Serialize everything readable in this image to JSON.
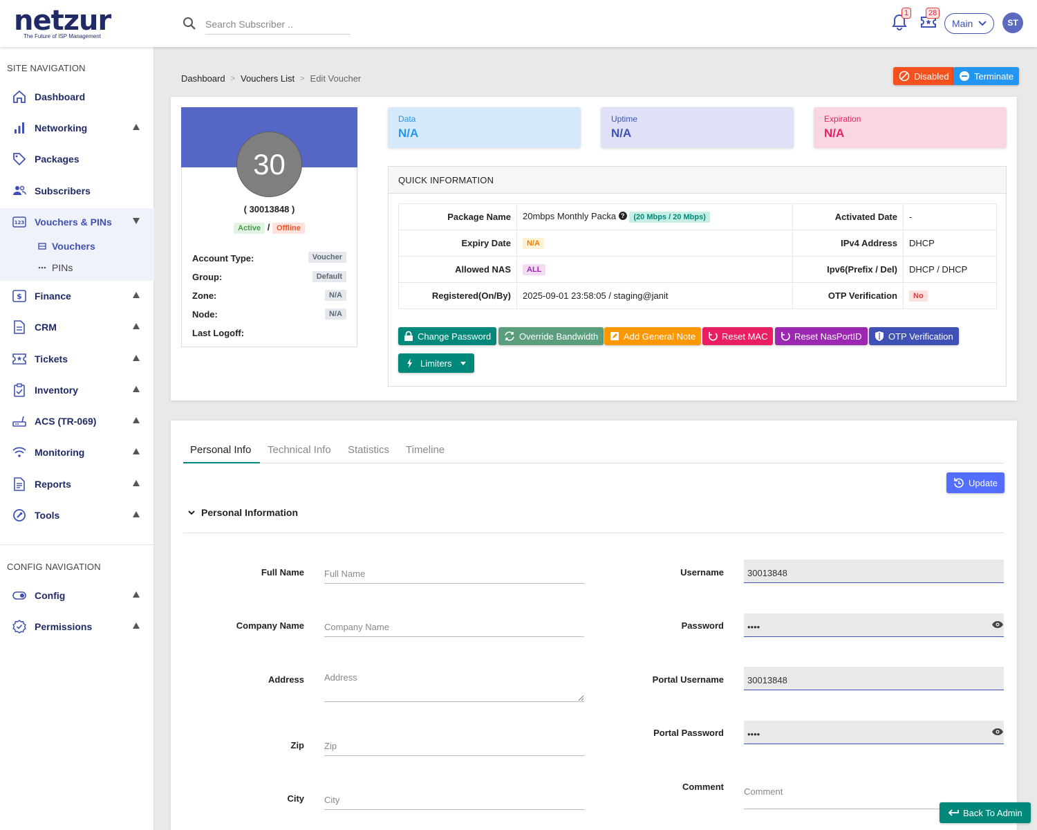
{
  "logo": {
    "word": "netzur",
    "tagline": "The Future of ISP Management"
  },
  "header": {
    "search_placeholder": "Search Subscriber ..",
    "notifications_count": "1",
    "tickets_count": "28",
    "branch": "Main",
    "user_initials": "ST"
  },
  "sidebar": {
    "site_heading": "SITE NAVIGATION",
    "items": [
      {
        "label": "Dashboard"
      },
      {
        "label": "Networking"
      },
      {
        "label": "Packages"
      },
      {
        "label": "Subscribers"
      },
      {
        "label": "Vouchers & PINs"
      },
      {
        "label": "Finance"
      },
      {
        "label": "CRM"
      },
      {
        "label": "Tickets"
      },
      {
        "label": "Inventory"
      },
      {
        "label": "ACS (TR-069)"
      },
      {
        "label": "Monitoring"
      },
      {
        "label": "Reports"
      },
      {
        "label": "Tools"
      }
    ],
    "sub_items": [
      {
        "label": "Vouchers"
      },
      {
        "label": "PINs"
      }
    ],
    "config_heading": "CONFIG NAVIGATION",
    "config_items": [
      {
        "label": "Config"
      },
      {
        "label": "Permissions"
      }
    ]
  },
  "breadcrumb": {
    "home": "Dashboard",
    "list": "Vouchers List",
    "current": "Edit Voucher"
  },
  "actions": {
    "disabled": "Disabled",
    "terminate": "Terminate"
  },
  "profile": {
    "number": "30",
    "id": "( 30013848 )",
    "status_active": "Active",
    "status_sep": "/",
    "status_offline": "Offline",
    "rows": [
      {
        "label": "Account Type:",
        "value": "Voucher"
      },
      {
        "label": "Group:",
        "value": "Default"
      },
      {
        "label": "Zone:",
        "value": "N/A"
      },
      {
        "label": "Node:",
        "value": "N/A"
      },
      {
        "label": "Last Logoff:",
        "value": ""
      }
    ]
  },
  "stats": [
    {
      "label": "Data",
      "value": "N/A"
    },
    {
      "label": "Uptime",
      "value": "N/A"
    },
    {
      "label": "Expiration",
      "value": "N/A"
    }
  ],
  "quick_info": {
    "title": "QUICK INFORMATION",
    "package_name_label": "Package Name",
    "package_name": "20mbps Monthly Packa",
    "package_speed": "(20 Mbps / 20 Mbps)",
    "activated_label": "Activated Date",
    "activated": "-",
    "expiry_label": "Expiry Date",
    "expiry": "N/A",
    "ipv4_label": "IPv4 Address",
    "ipv4": "DHCP",
    "nas_label": "Allowed NAS",
    "nas": "ALL",
    "ipv6_label": "Ipv6(Prefix / Del)",
    "ipv6": "DHCP / DHCP",
    "registered_label": "Registered(On/By)",
    "registered": "2025-09-01 23:58:05 / staging@janit",
    "otp_label": "OTP Verification",
    "otp": "No"
  },
  "qi_buttons": {
    "change_password": "Change Password",
    "override_bandwidth": "Override Bandwidth",
    "add_note": "Add General Note",
    "reset_mac": "Reset MAC",
    "reset_nas": "Reset NasPortID",
    "otp": "OTP Verification",
    "limiters": "Limiters"
  },
  "tabs": [
    "Personal Info",
    "Technical Info",
    "Statistics",
    "Timeline"
  ],
  "update_label": "Update",
  "section_title": "Personal Information",
  "form": {
    "full_name": {
      "label": "Full Name",
      "placeholder": "Full Name"
    },
    "company": {
      "label": "Company Name",
      "placeholder": "Company Name"
    },
    "address": {
      "label": "Address",
      "placeholder": "Address"
    },
    "zip": {
      "label": "Zip",
      "placeholder": "Zip"
    },
    "city": {
      "label": "City",
      "placeholder": "City"
    },
    "username": {
      "label": "Username",
      "value": "30013848"
    },
    "password": {
      "label": "Password",
      "value": "••••"
    },
    "portal_username": {
      "label": "Portal Username",
      "value": "30013848"
    },
    "portal_password": {
      "label": "Portal Password",
      "value": "••••"
    },
    "comment": {
      "label": "Comment",
      "placeholder": "Comment"
    }
  },
  "back_to_admin": "Back To Admin",
  "colors": {
    "brand": "#1f2a66",
    "accent": "#3f51b5",
    "teal": "#00897b"
  }
}
